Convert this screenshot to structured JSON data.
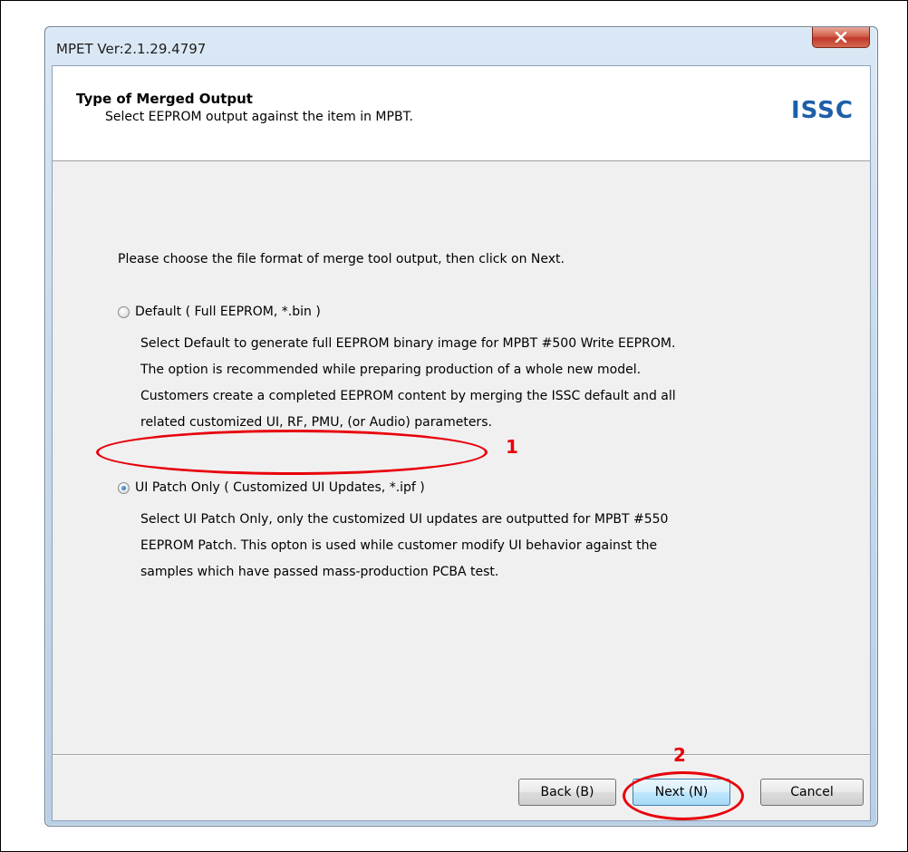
{
  "window": {
    "title": "MPET Ver:2.1.29.4797",
    "close_label": "x"
  },
  "header": {
    "title": "Type of Merged Output",
    "subtitle": "Select EEPROM output against the item in MPBT.",
    "logo": "ISSC"
  },
  "body": {
    "instruction": "Please choose the file format of merge tool output, then click on Next.",
    "options": [
      {
        "label": "Default  ( Full EEPROM, *.bin )",
        "checked": false,
        "description": [
          "Select Default to generate full EEPROM binary image for MPBT #500 Write EEPROM.",
          "The option is recommended while preparing production of a whole new model.",
          "Customers create a completed EEPROM content by merging the ISSC default and all",
          "related customized UI, RF, PMU, (or Audio) parameters."
        ]
      },
      {
        "label": "UI Patch Only  ( Customized UI Updates, *.ipf )",
        "checked": true,
        "description": [
          "Select UI Patch Only, only the customized UI updates are outputted for MPBT #550",
          "EEPROM Patch. This opton is used while customer modify UI behavior against the",
          "samples which have passed mass-production PCBA test."
        ]
      }
    ]
  },
  "buttons": {
    "back": "Back (B)",
    "next": "Next (N)",
    "cancel": "Cancel"
  },
  "annotations": {
    "marker_1": "1",
    "marker_2": "2",
    "color": "#e8000b"
  },
  "colors": {
    "logo": "#1d5fa8",
    "header_bg": "#ffffff",
    "client_bg": "#f0f0f0"
  }
}
